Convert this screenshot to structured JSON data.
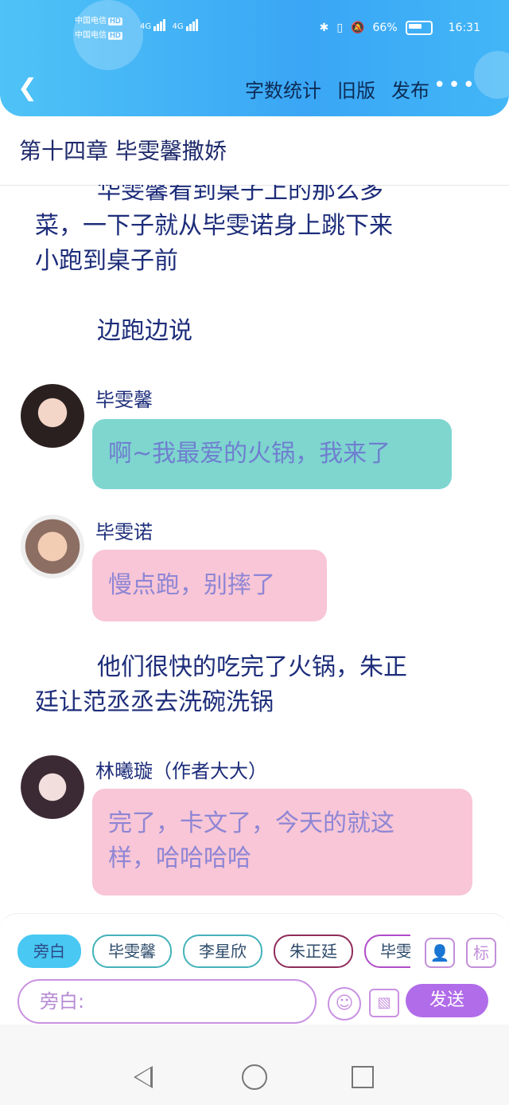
{
  "status_bar": {
    "carrier_1": "中国电信",
    "carrier_2": "中国电信",
    "hd": "HD",
    "network": "4G",
    "battery": "66%",
    "time": "16:31"
  },
  "header": {
    "actions": [
      "字数统计",
      "旧版",
      "发布"
    ],
    "more": "•••"
  },
  "chapter": {
    "title": "第十四章  毕雯馨撒娇"
  },
  "content": {
    "para1_partial": "华雯馨看到桌子上的那么多",
    "para1_line2": "菜，一下子就从毕雯诺身上跳下来",
    "para1_line3": "小跑到桌子前",
    "para2": "边跑边说",
    "msg1": {
      "name": "毕雯馨",
      "text": "啊~我最爱的火锅，我来了"
    },
    "msg2": {
      "name": "毕雯诺",
      "text": "慢点跑，别摔了"
    },
    "para3_line1": "他们很快的吃完了火锅，朱正",
    "para3_line2": "廷让范丞丞去洗碗洗锅",
    "msg3": {
      "name": "林曦璇（作者大大）",
      "line1": "完了，卡文了，今天的就这",
      "line2": "样，哈哈哈哈"
    }
  },
  "composer": {
    "chips": [
      "旁白",
      "毕雯馨",
      "李星欣",
      "朱正廷",
      "毕雯"
    ],
    "placeholder": "旁白:",
    "send": "发送",
    "mark": "标"
  },
  "colors": {
    "header": "#3aa6f5",
    "text": "#1d2d7a",
    "bubble_teal": "#7ed6cf",
    "bubble_pink": "#f8c6d6",
    "send": "#b16ce9"
  }
}
